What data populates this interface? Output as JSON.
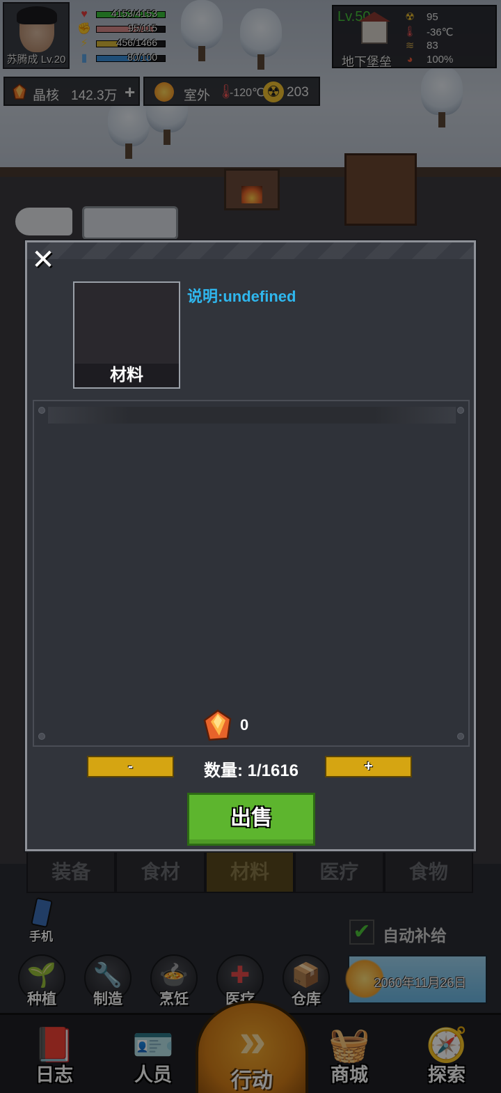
{
  "player": {
    "name_level": "苏腾成 Lv.20",
    "stats": [
      {
        "icon": "heart-icon",
        "glyph": "♥",
        "text": "4153/4153",
        "fill": 1.0,
        "color": "#3bbf3b",
        "icon_color": "#e23b3b"
      },
      {
        "icon": "muscle-icon",
        "glyph": "✊",
        "text": "95/115",
        "fill": 0.83,
        "color": "#d98a8a",
        "icon_color": "#e8c8b0"
      },
      {
        "icon": "lightning-icon",
        "glyph": "⚡",
        "text": "456/1466",
        "fill": 0.31,
        "color": "#d9b83a",
        "icon_color": "#f2c230"
      },
      {
        "icon": "water-icon",
        "glyph": "▮",
        "text": "80/100",
        "fill": 0.8,
        "color": "#3a8ed9",
        "icon_color": "#5aa0e0"
      }
    ]
  },
  "resources": {
    "crystal_label": "晶核",
    "crystal_value": "142.3万",
    "plus": "+"
  },
  "outside": {
    "label": "室外",
    "temperature": "-120℃",
    "radiation_icon": "☢",
    "radiation": "203"
  },
  "base": {
    "level": "Lv.50",
    "name": "地下堡垒",
    "stats": [
      {
        "icon": "radiation-icon",
        "glyph": "☢",
        "value": "95",
        "color": "#f2c230"
      },
      {
        "icon": "thermometer-icon",
        "glyph": "🌡",
        "value": "-36℃",
        "color": "#e55"
      },
      {
        "icon": "layers-icon",
        "glyph": "≋",
        "value": "83",
        "color": "#c9a24a"
      },
      {
        "icon": "gauge-icon",
        "glyph": "◕",
        "value": "100%",
        "color": "#e0583a"
      }
    ]
  },
  "modal": {
    "close": "✕",
    "item_caption": "材料",
    "description": "说明:undefined",
    "price_value": "0",
    "minus": "-",
    "plus": "+",
    "quantity": "数量: 1/1616",
    "sell": "出售"
  },
  "category_tabs": [
    {
      "label": "装备",
      "active": false
    },
    {
      "label": "食材",
      "active": false
    },
    {
      "label": "材料",
      "active": true
    },
    {
      "label": "医疗",
      "active": false
    },
    {
      "label": "食物",
      "active": false
    }
  ],
  "hud": {
    "phone_label": "手机",
    "auto_supply_label": "自动补给",
    "auto_supply_checked": true,
    "check_glyph": "✔",
    "round_buttons": [
      {
        "name": "planting",
        "label": "种植",
        "glyph": "🌱"
      },
      {
        "name": "crafting",
        "label": "制造",
        "glyph": "🔧"
      },
      {
        "name": "cooking",
        "label": "烹饪",
        "glyph": "🍲"
      },
      {
        "name": "medical",
        "label": "医疗",
        "glyph": "✚"
      },
      {
        "name": "warehouse",
        "label": "仓库",
        "glyph": "📦"
      }
    ],
    "date": "2060年11月26日"
  },
  "bottom_nav": [
    {
      "name": "log",
      "label": "日志",
      "glyph": "📕"
    },
    {
      "name": "personnel",
      "label": "人员",
      "glyph": "🪪"
    },
    {
      "name": "action",
      "label": "行动",
      "glyph": "»"
    },
    {
      "name": "shop",
      "label": "商城",
      "glyph": "🧺"
    },
    {
      "name": "explore",
      "label": "探索",
      "glyph": "🧭"
    }
  ]
}
